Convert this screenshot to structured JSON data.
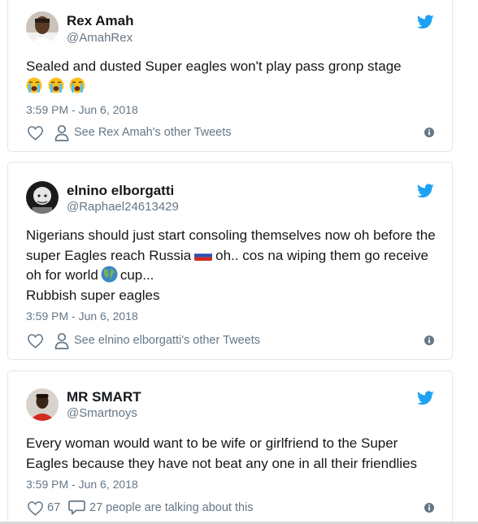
{
  "tweets": [
    {
      "name": "Rex Amah",
      "handle": "@AmahRex",
      "text": "Sealed and dusted Super eagles won't play pass gronp stage",
      "emoji": [
        "loudly-crying-face",
        "loudly-crying-face",
        "loudly-crying-face"
      ],
      "time": "3:59 PM - Jun 6, 2018",
      "other_tweets": "See Rex Amah's other Tweets"
    },
    {
      "name": "elnino elborgatti",
      "handle": "@Raphael24613429",
      "text_a": "Nigerians should just start consoling themselves now oh before the super Eagles reach Russia",
      "text_b": "oh.. cos na wiping them go receive oh for world",
      "text_c": "cup...",
      "text_d": "Rubbish super eagles",
      "inline_icons": [
        "russia-flag",
        "globe"
      ],
      "time": "3:59 PM - Jun 6, 2018",
      "other_tweets": "See elnino elborgatti's other Tweets"
    },
    {
      "name": "MR SMART",
      "handle": "@Smartnoys",
      "text": "Every woman would want to be wife or girlfriend to the Super Eagles because they have not beat any one in all their friendlies",
      "time": "3:59 PM - Jun 6, 2018",
      "likes": "67",
      "talking": "27 people are talking about this"
    }
  ],
  "colors": {
    "twitter_blue": "#1da1f2",
    "text": "#14171a",
    "secondary": "#657786",
    "border": "#e1e8ed"
  }
}
